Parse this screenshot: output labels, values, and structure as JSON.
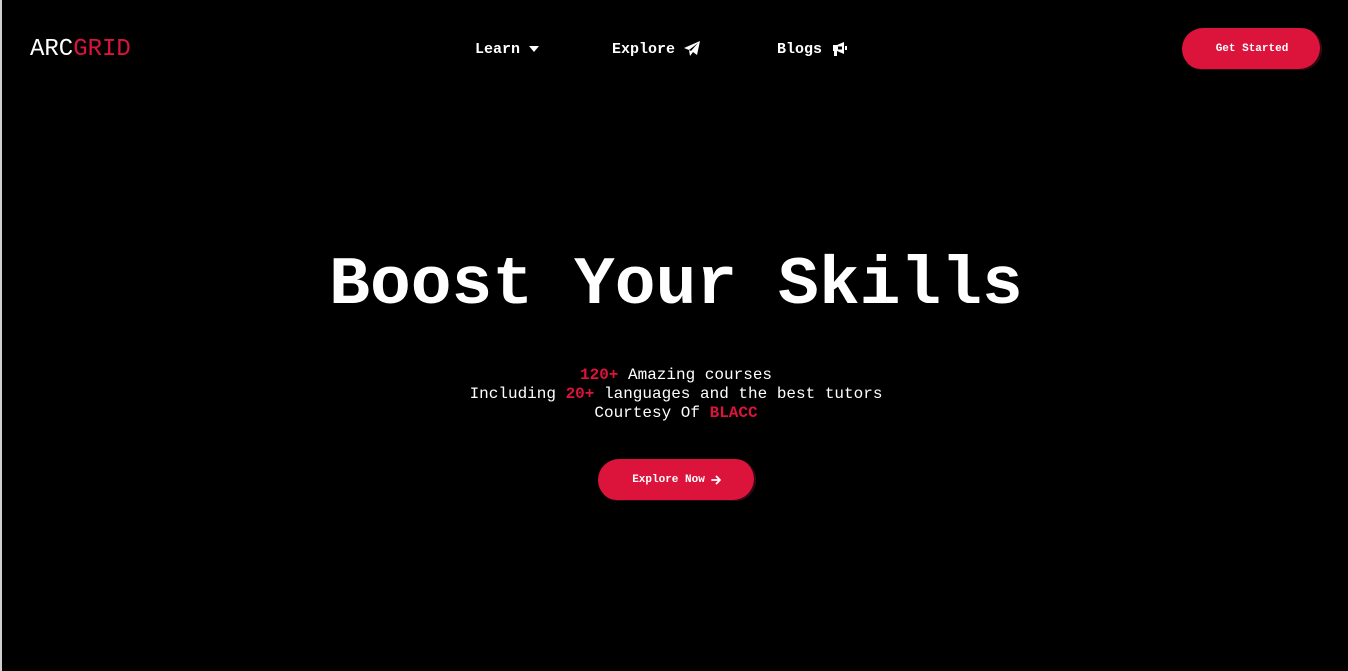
{
  "brand": {
    "part1": "ARC",
    "part2": "GRID"
  },
  "nav": {
    "items": [
      {
        "label": "Learn",
        "icon": "caret-down-icon"
      },
      {
        "label": "Explore",
        "icon": "paper-plane-icon"
      },
      {
        "label": "Blogs",
        "icon": "megaphone-icon"
      }
    ],
    "cta_label": "Get Started"
  },
  "hero": {
    "title": "Boost Your Skills",
    "line1": {
      "highlight": "120+",
      "text": " Amazing courses"
    },
    "line2": {
      "prefix": "Including ",
      "highlight": "20+",
      "suffix": " languages and the best tutors"
    },
    "line3": {
      "prefix": "Courtesy Of ",
      "highlight": "BLACC"
    },
    "cta_label": "Explore Now",
    "cta_icon": "arrow-right-icon"
  },
  "colors": {
    "background": "#000000",
    "accent": "#dc143c",
    "text": "#ffffff"
  }
}
